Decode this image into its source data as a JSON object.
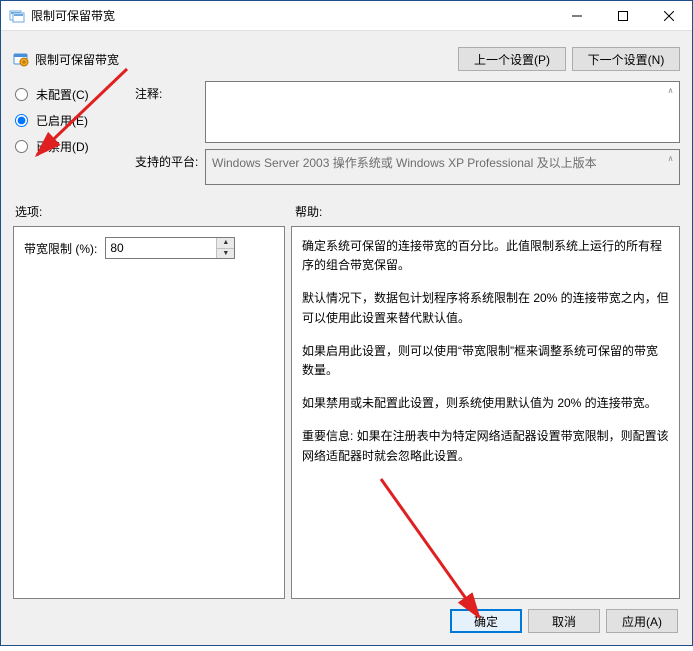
{
  "window": {
    "title": "限制可保留带宽"
  },
  "header": {
    "policy_name": "限制可保留带宽",
    "prev_setting_btn": "上一个设置(P)",
    "next_setting_btn": "下一个设置(N)"
  },
  "radios": {
    "not_configured": "未配置(C)",
    "enabled": "已启用(E)",
    "disabled": "已禁用(D)",
    "selected": "enabled"
  },
  "comment": {
    "label": "注释:",
    "value": ""
  },
  "platform": {
    "label": "支持的平台:",
    "value": "Windows Server 2003 操作系统或 Windows XP Professional 及以上版本"
  },
  "labels": {
    "options": "选项:",
    "help": "帮助:"
  },
  "options": {
    "bandwidth_limit_label": "带宽限制 (%):",
    "bandwidth_limit_value": "80"
  },
  "help": {
    "p1": "确定系统可保留的连接带宽的百分比。此值限制系统上运行的所有程序的组合带宽保留。",
    "p2": "默认情况下，数据包计划程序将系统限制在 20% 的连接带宽之内，但可以使用此设置来替代默认值。",
    "p3": "如果启用此设置，则可以使用“带宽限制”框来调整系统可保留的带宽数量。",
    "p4": "如果禁用或未配置此设置，则系统使用默认值为 20% 的连接带宽。",
    "p5": "重要信息: 如果在注册表中为特定网络适配器设置带宽限制，则配置该网络适配器时就会忽略此设置。"
  },
  "footer": {
    "ok": "确定",
    "cancel": "取消",
    "apply": "应用(A)"
  },
  "icons": {
    "policy": "policy-icon"
  }
}
